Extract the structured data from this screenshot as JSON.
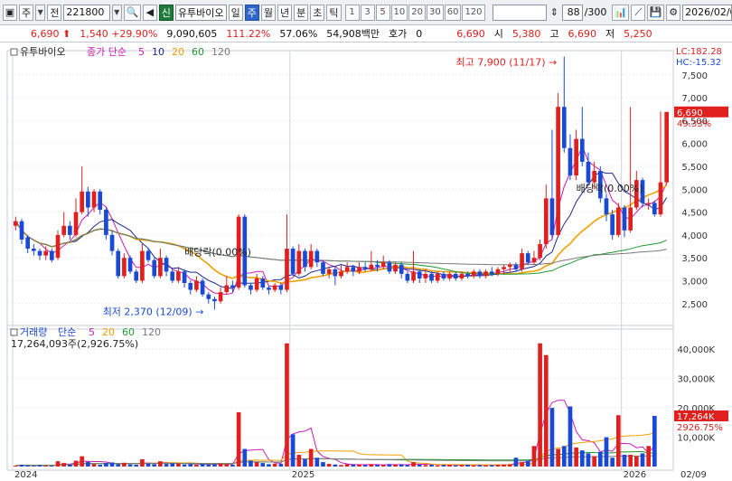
{
  "toolbar": {
    "market_label": "주",
    "market_prefix": "전",
    "code": "221800",
    "listed_badge": "신",
    "stock_name": "유투바이오",
    "periods": [
      "일",
      "주",
      "월",
      "년",
      "분",
      "초",
      "틱"
    ],
    "active_period": "주",
    "intervals": [
      "1",
      "3",
      "5",
      "10",
      "20",
      "30",
      "60",
      "120"
    ],
    "zoom_count": "88",
    "zoom_total": "/300",
    "date_value": "2026/02/0",
    "icons": [
      "view-icon",
      "speaker-icon",
      "chart-type-icon",
      "indicator-icon",
      "save-icon",
      "settings-icon"
    ]
  },
  "quote": {
    "price": "6,690",
    "change": "1,540",
    "change_pct": "+29.90%",
    "volume": "9,090,605",
    "vol_ratio": "111.22%",
    "turnover": "57.06%",
    "amount": "54,908백만",
    "hoga_label": "호가",
    "hoga_value": "0",
    "hoga_price": "6,690",
    "open_label": "시",
    "open": "5,380",
    "high_label": "고",
    "high": "6,690",
    "low_label": "저",
    "low": "5,250"
  },
  "price_panel": {
    "legend_name": "유투바이오",
    "legend_label": "종가 단순",
    "ma_periods": [
      "5",
      "10",
      "20",
      "60",
      "120"
    ],
    "lc_label": "LC:182.28",
    "hc_label": "HC:-15.32",
    "last_price_tag": "6,690",
    "last_pct_tag": "49.33%",
    "max_annotation": "최고 7,900 (11/17)",
    "min_annotation": "최저 2,370 (12/09)",
    "ex_dividend_1": "배당락(0.00%)",
    "ex_dividend_2": "배당락(0.00%)",
    "y_ticks": [
      "7,500",
      "7,000",
      "6,500",
      "6,000",
      "5,500",
      "5,000",
      "4,500",
      "4,000",
      "3,500",
      "3,000",
      "2,500"
    ]
  },
  "volume_panel": {
    "legend_name": "거래량",
    "legend_label": "단순",
    "ma_periods": [
      "5",
      "20",
      "60",
      "120"
    ],
    "summary": "17,264,093주(2,926.75%)",
    "last_tag": "17,264K",
    "last_pct_tag": "2926.75%",
    "y_ticks": [
      "40,000K",
      "30,000K",
      "20,000K",
      "10,000K"
    ]
  },
  "x_axis": [
    "2024",
    "2025",
    "2026",
    "02/09"
  ],
  "colors": {
    "up": "#e0201e",
    "down": "#1a49d6",
    "ma5": "#c81eb4",
    "ma10": "#1c2a8c",
    "ma20": "#f0a000",
    "ma60": "#1f9a30",
    "ma120": "#7a7a7a"
  },
  "chart_data": {
    "type": "candlestick",
    "period": "weekly",
    "ylim": [
      2200,
      7900
    ],
    "candles": [
      {
        "o": 4200,
        "c": 4300,
        "h": 4400,
        "l": 4100
      },
      {
        "o": 4300,
        "c": 3900,
        "h": 4350,
        "l": 3800
      },
      {
        "o": 3950,
        "c": 3700,
        "h": 4000,
        "l": 3600
      },
      {
        "o": 3700,
        "c": 3650,
        "h": 3800,
        "l": 3550
      },
      {
        "o": 3650,
        "c": 3550,
        "h": 3700,
        "l": 3450
      },
      {
        "o": 3550,
        "c": 3650,
        "h": 3750,
        "l": 3450
      },
      {
        "o": 3650,
        "c": 3450,
        "h": 3700,
        "l": 3400
      },
      {
        "o": 3500,
        "c": 4000,
        "h": 4100,
        "l": 3450
      },
      {
        "o": 4000,
        "c": 4200,
        "h": 4500,
        "l": 3950
      },
      {
        "o": 4200,
        "c": 4000,
        "h": 4300,
        "l": 3900
      },
      {
        "o": 4000,
        "c": 4500,
        "h": 4800,
        "l": 3950
      },
      {
        "o": 4500,
        "c": 4950,
        "h": 5500,
        "l": 4450
      },
      {
        "o": 4950,
        "c": 4600,
        "h": 5050,
        "l": 4400
      },
      {
        "o": 4600,
        "c": 4950,
        "h": 5000,
        "l": 4500
      },
      {
        "o": 4950,
        "c": 4550,
        "h": 5000,
        "l": 4450
      },
      {
        "o": 4550,
        "c": 4000,
        "h": 4600,
        "l": 3900
      },
      {
        "o": 4000,
        "c": 3650,
        "h": 4100,
        "l": 3550
      },
      {
        "o": 3650,
        "c": 3100,
        "h": 3700,
        "l": 3050
      },
      {
        "o": 3100,
        "c": 3500,
        "h": 3600,
        "l": 3050
      },
      {
        "o": 3500,
        "c": 3200,
        "h": 3550,
        "l": 3150
      },
      {
        "o": 3200,
        "c": 3000,
        "h": 3250,
        "l": 2950
      },
      {
        "o": 3000,
        "c": 3650,
        "h": 3800,
        "l": 2950
      },
      {
        "o": 3650,
        "c": 3450,
        "h": 3700,
        "l": 3400
      },
      {
        "o": 3450,
        "c": 3100,
        "h": 3500,
        "l": 3050
      },
      {
        "o": 3100,
        "c": 3500,
        "h": 3700,
        "l": 3050
      },
      {
        "o": 3500,
        "c": 3200,
        "h": 3550,
        "l": 3100
      },
      {
        "o": 3200,
        "c": 3000,
        "h": 3250,
        "l": 2950
      },
      {
        "o": 3000,
        "c": 3200,
        "h": 3300,
        "l": 2950
      },
      {
        "o": 3200,
        "c": 2950,
        "h": 3250,
        "l": 2850
      },
      {
        "o": 2950,
        "c": 2800,
        "h": 3000,
        "l": 2700
      },
      {
        "o": 2800,
        "c": 3000,
        "h": 3100,
        "l": 2750
      },
      {
        "o": 3000,
        "c": 2700,
        "h": 3050,
        "l": 2650
      },
      {
        "o": 2700,
        "c": 2600,
        "h": 2750,
        "l": 2500
      },
      {
        "o": 2600,
        "c": 2550,
        "h": 2650,
        "l": 2370
      },
      {
        "o": 2550,
        "c": 2750,
        "h": 2850,
        "l": 2500
      },
      {
        "o": 2750,
        "c": 2900,
        "h": 3100,
        "l": 2700
      },
      {
        "o": 2900,
        "c": 2850,
        "h": 3000,
        "l": 2750
      },
      {
        "o": 2850,
        "c": 4400,
        "h": 4450,
        "l": 2800
      },
      {
        "o": 4400,
        "c": 2900,
        "h": 4450,
        "l": 2850
      },
      {
        "o": 2900,
        "c": 2800,
        "h": 2950,
        "l": 2700
      },
      {
        "o": 2800,
        "c": 3050,
        "h": 3150,
        "l": 2750
      },
      {
        "o": 3050,
        "c": 2850,
        "h": 3100,
        "l": 2800
      },
      {
        "o": 2850,
        "c": 2800,
        "h": 2900,
        "l": 2700
      },
      {
        "o": 2800,
        "c": 2900,
        "h": 2950,
        "l": 2750
      },
      {
        "o": 2900,
        "c": 2800,
        "h": 2950,
        "l": 2700
      },
      {
        "o": 2800,
        "c": 3700,
        "h": 4450,
        "l": 2750
      },
      {
        "o": 3700,
        "c": 3150,
        "h": 3750,
        "l": 3100
      },
      {
        "o": 3150,
        "c": 3650,
        "h": 3800,
        "l": 3100
      },
      {
        "o": 3650,
        "c": 3300,
        "h": 3700,
        "l": 3200
      },
      {
        "o": 3300,
        "c": 3650,
        "h": 3800,
        "l": 3250
      },
      {
        "o": 3650,
        "c": 3400,
        "h": 3700,
        "l": 3300
      },
      {
        "o": 3400,
        "c": 3150,
        "h": 3450,
        "l": 3100
      },
      {
        "o": 3150,
        "c": 3250,
        "h": 3300,
        "l": 3050
      },
      {
        "o": 3250,
        "c": 3100,
        "h": 3300,
        "l": 2900
      },
      {
        "o": 3100,
        "c": 3200,
        "h": 3350,
        "l": 3050
      },
      {
        "o": 3200,
        "c": 3300,
        "h": 3400,
        "l": 3150
      },
      {
        "o": 3300,
        "c": 3200,
        "h": 3350,
        "l": 3100
      },
      {
        "o": 3200,
        "c": 3300,
        "h": 3400,
        "l": 3150
      },
      {
        "o": 3300,
        "c": 3250,
        "h": 3400,
        "l": 3200
      },
      {
        "o": 3250,
        "c": 3350,
        "h": 3650,
        "l": 3200
      },
      {
        "o": 3350,
        "c": 3300,
        "h": 3450,
        "l": 3200
      },
      {
        "o": 3300,
        "c": 3400,
        "h": 3550,
        "l": 3250
      },
      {
        "o": 3400,
        "c": 3200,
        "h": 3450,
        "l": 3150
      },
      {
        "o": 3200,
        "c": 3350,
        "h": 3400,
        "l": 3150
      },
      {
        "o": 3350,
        "c": 3150,
        "h": 3400,
        "l": 3050
      },
      {
        "o": 3150,
        "c": 3000,
        "h": 3200,
        "l": 2950
      },
      {
        "o": 3000,
        "c": 3200,
        "h": 3650,
        "l": 2950
      },
      {
        "o": 3200,
        "c": 3050,
        "h": 3250,
        "l": 2950
      },
      {
        "o": 3050,
        "c": 3150,
        "h": 3250,
        "l": 2950
      },
      {
        "o": 3150,
        "c": 3000,
        "h": 3200,
        "l": 2950
      },
      {
        "o": 3000,
        "c": 3150,
        "h": 3200,
        "l": 2950
      },
      {
        "o": 3150,
        "c": 3050,
        "h": 3200,
        "l": 3000
      },
      {
        "o": 3050,
        "c": 3150,
        "h": 3200,
        "l": 3000
      },
      {
        "o": 3150,
        "c": 3050,
        "h": 3200,
        "l": 3000
      },
      {
        "o": 3050,
        "c": 3150,
        "h": 3200,
        "l": 3000
      },
      {
        "o": 3150,
        "c": 3100,
        "h": 3200,
        "l": 3050
      },
      {
        "o": 3100,
        "c": 3200,
        "h": 3250,
        "l": 3050
      },
      {
        "o": 3200,
        "c": 3100,
        "h": 3250,
        "l": 3050
      },
      {
        "o": 3100,
        "c": 3200,
        "h": 3250,
        "l": 3050
      },
      {
        "o": 3200,
        "c": 3150,
        "h": 3300,
        "l": 3100
      },
      {
        "o": 3150,
        "c": 3250,
        "h": 3300,
        "l": 3100
      },
      {
        "o": 3250,
        "c": 3300,
        "h": 3350,
        "l": 3150
      },
      {
        "o": 3300,
        "c": 3350,
        "h": 3400,
        "l": 3200
      },
      {
        "o": 3350,
        "c": 3250,
        "h": 3400,
        "l": 3200
      },
      {
        "o": 3250,
        "c": 3600,
        "h": 3700,
        "l": 3200
      },
      {
        "o": 3600,
        "c": 3400,
        "h": 3650,
        "l": 3350
      },
      {
        "o": 3400,
        "c": 3500,
        "h": 3650,
        "l": 3350
      },
      {
        "o": 3500,
        "c": 3800,
        "h": 3900,
        "l": 3450
      },
      {
        "o": 3800,
        "c": 4800,
        "h": 5100,
        "l": 3700
      },
      {
        "o": 4800,
        "c": 4000,
        "h": 6300,
        "l": 3900
      },
      {
        "o": 4000,
        "c": 6800,
        "h": 7100,
        "l": 3950
      },
      {
        "o": 6800,
        "c": 5900,
        "h": 7900,
        "l": 5800
      },
      {
        "o": 5900,
        "c": 5300,
        "h": 6200,
        "l": 5200
      },
      {
        "o": 5300,
        "c": 6100,
        "h": 6300,
        "l": 5200
      },
      {
        "o": 6100,
        "c": 5600,
        "h": 6800,
        "l": 5500
      },
      {
        "o": 5600,
        "c": 5150,
        "h": 5800,
        "l": 5100
      },
      {
        "o": 5150,
        "c": 5400,
        "h": 5600,
        "l": 5000
      },
      {
        "o": 5400,
        "c": 4800,
        "h": 5500,
        "l": 4700
      },
      {
        "o": 4800,
        "c": 4450,
        "h": 4900,
        "l": 4300
      },
      {
        "o": 4450,
        "c": 4000,
        "h": 4550,
        "l": 3900
      },
      {
        "o": 4000,
        "c": 4600,
        "h": 4700,
        "l": 3950
      },
      {
        "o": 4600,
        "c": 4100,
        "h": 4650,
        "l": 3950
      },
      {
        "o": 4100,
        "c": 4600,
        "h": 6800,
        "l": 4050
      },
      {
        "o": 4600,
        "c": 5200,
        "h": 5400,
        "l": 4550
      },
      {
        "o": 5200,
        "c": 4700,
        "h": 5250,
        "l": 4600
      },
      {
        "o": 4700,
        "c": 4700,
        "h": 4800,
        "l": 4550
      },
      {
        "o": 4700,
        "c": 4450,
        "h": 4750,
        "l": 4400
      },
      {
        "o": 4450,
        "c": 5150,
        "h": 6700,
        "l": 4400
      },
      {
        "o": 5150,
        "c": 6690,
        "h": 6690,
        "l": 5100
      }
    ],
    "volume": {
      "unit": "K shares",
      "values": [
        300,
        600,
        400,
        200,
        500,
        300,
        250,
        1800,
        1200,
        600,
        2000,
        3500,
        1600,
        800,
        600,
        1200,
        1400,
        800,
        1300,
        700,
        600,
        2500,
        1000,
        800,
        1800,
        900,
        1100,
        1000,
        700,
        800,
        600,
        900,
        700,
        800,
        1000,
        800,
        600,
        18500,
        6000,
        2000,
        1500,
        1200,
        800,
        1000,
        900,
        42000,
        11000,
        4000,
        2500,
        6000,
        3000,
        1500,
        900,
        700,
        500,
        800,
        700,
        600,
        500,
        800,
        600,
        500,
        800,
        600,
        700,
        500,
        1500,
        600,
        500,
        600,
        400,
        500,
        600,
        400,
        500,
        600,
        400,
        500,
        400,
        500,
        600,
        700,
        800,
        3000,
        1500,
        2000,
        7000,
        42000,
        38000,
        20000,
        6000,
        7000,
        20500,
        6500,
        5500,
        4500,
        3500,
        5000,
        10000,
        3000,
        17500,
        4000,
        4000,
        3500,
        4500,
        7000,
        17264
      ]
    }
  }
}
